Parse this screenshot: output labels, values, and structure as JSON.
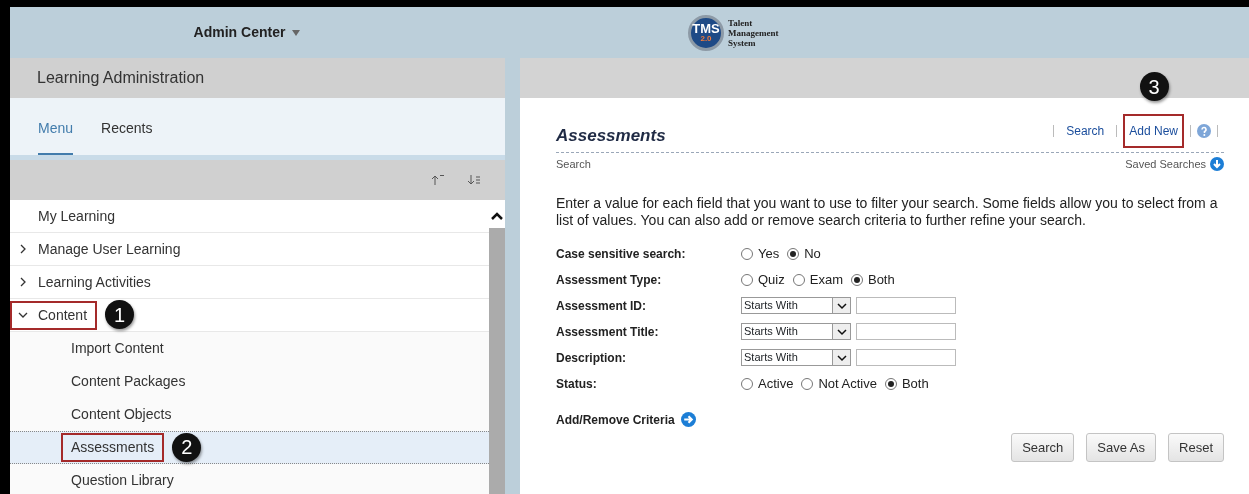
{
  "header": {
    "menu_title": "Admin Center",
    "logo": {
      "mark": "TMS",
      "version": "2.0",
      "lines": [
        "Talent",
        "Management",
        "System"
      ]
    }
  },
  "left_panel": {
    "title": "Learning Administration",
    "tabs": [
      {
        "label": "Menu",
        "selected": true
      },
      {
        "label": "Recents",
        "selected": false
      }
    ],
    "tree": [
      {
        "label": "My Learning",
        "kind": "link",
        "selected": false,
        "boxed": false
      },
      {
        "label": "Manage User Learning",
        "kind": "folder",
        "expanded": false,
        "selected": false,
        "boxed": false
      },
      {
        "label": "Learning Activities",
        "kind": "folder",
        "expanded": false,
        "selected": false,
        "boxed": false
      },
      {
        "label": "Content",
        "kind": "folder",
        "expanded": true,
        "selected": false,
        "boxed": true,
        "callout": "1",
        "children": [
          {
            "label": "Import Content",
            "selected": false,
            "boxed": false
          },
          {
            "label": "Content Packages",
            "selected": false,
            "boxed": false
          },
          {
            "label": "Content Objects",
            "selected": false,
            "boxed": false
          },
          {
            "label": "Assessments",
            "selected": true,
            "boxed": true,
            "callout": "2"
          },
          {
            "label": "Question Library",
            "selected": false,
            "boxed": false
          }
        ]
      }
    ]
  },
  "main": {
    "title": "Assessments",
    "subtitle": "Search",
    "actions": [
      {
        "label": "Search",
        "boxed": false
      },
      {
        "label": "Add New",
        "boxed": true,
        "callout": "3"
      }
    ],
    "saved_searches": "Saved Searches",
    "intro": "Enter a value for each field that you want to use to filter your search. Some fields allow you to select from a list of values. You can also add or remove search criteria to further refine your search.",
    "fields": [
      {
        "kind": "radio",
        "label": "Case sensitive search:",
        "options": [
          {
            "label": "Yes",
            "selected": false
          },
          {
            "label": "No",
            "selected": true
          }
        ]
      },
      {
        "kind": "radio",
        "label": "Assessment Type:",
        "options": [
          {
            "label": "Quiz",
            "selected": false
          },
          {
            "label": "Exam",
            "selected": false
          },
          {
            "label": "Both",
            "selected": true
          }
        ]
      },
      {
        "kind": "text",
        "label": "Assessment ID:",
        "operator": "Starts With"
      },
      {
        "kind": "text",
        "label": "Assessment Title:",
        "operator": "Starts With"
      },
      {
        "kind": "text",
        "label": "Description:",
        "operator": "Starts With"
      },
      {
        "kind": "radio",
        "label": "Status:",
        "options": [
          {
            "label": "Active",
            "selected": false
          },
          {
            "label": "Not Active",
            "selected": false
          },
          {
            "label": "Both",
            "selected": true
          }
        ]
      }
    ],
    "criteria_link": "Add/Remove Criteria",
    "buttons": [
      "Search",
      "Save As",
      "Reset"
    ]
  }
}
